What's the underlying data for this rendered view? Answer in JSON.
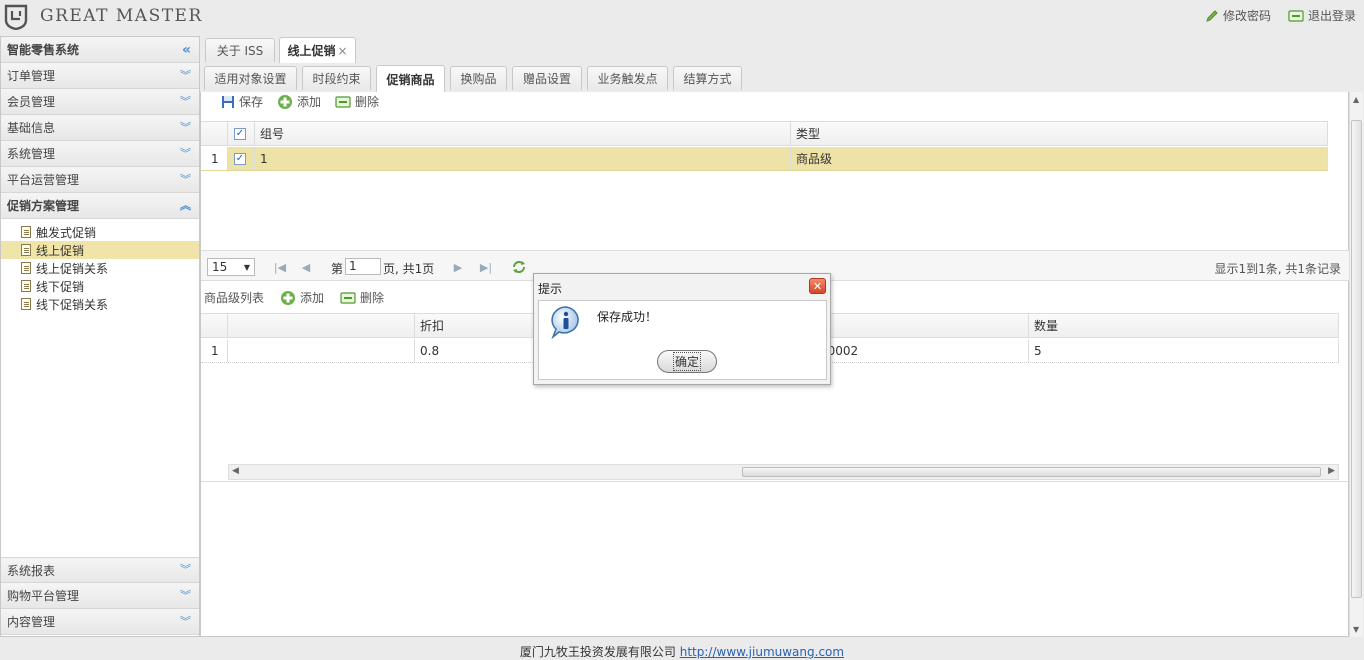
{
  "header": {
    "logo_text": "GREAT MASTER",
    "change_pwd": "修改密码",
    "logout": "退出登录"
  },
  "sidebar": {
    "title": "智能零售系统",
    "sections_top": [
      "订单管理",
      "会员管理",
      "基础信息",
      "系统管理",
      "平台运营管理"
    ],
    "open_section": "促销方案管理",
    "items": [
      "触发式促销",
      "线上促销",
      "线上促销关系",
      "线下促销",
      "线下促销关系"
    ],
    "sections_bottom": [
      "系统报表",
      "购物平台管理",
      "内容管理"
    ]
  },
  "tabs": {
    "about": "关于 ISS",
    "online": "线上促销",
    "close": "×"
  },
  "subtabs": [
    "适用对象设置",
    "时段约束",
    "促销商品",
    "换购品",
    "赠品设置",
    "业务触发点",
    "结算方式"
  ],
  "toolbar1": {
    "save": "保存",
    "add": "添加",
    "del": "删除"
  },
  "grid1": {
    "col_group": "组号",
    "col_type": "类型",
    "row_no": "1",
    "row_group": "1",
    "row_type": "商品级"
  },
  "pager": {
    "size": "15",
    "page_prefix": "第",
    "page_value": "1",
    "page_suffix": "页, 共1页",
    "info": "显示1到1条, 共1条记录"
  },
  "toolbar2": {
    "title": "商品级列表",
    "add": "添加",
    "del": "删除"
  },
  "grid2": {
    "col_discount": "折扣",
    "col_qty": "数量",
    "row_no": "1",
    "discount": "0.8",
    "code": "00002",
    "qty": "5"
  },
  "dialog": {
    "title": "提示",
    "message": "保存成功！",
    "ok": "确定"
  },
  "footer": {
    "company": "厦门九牧王投资发展有限公司",
    "url": "http://www.jiumuwang.com"
  }
}
